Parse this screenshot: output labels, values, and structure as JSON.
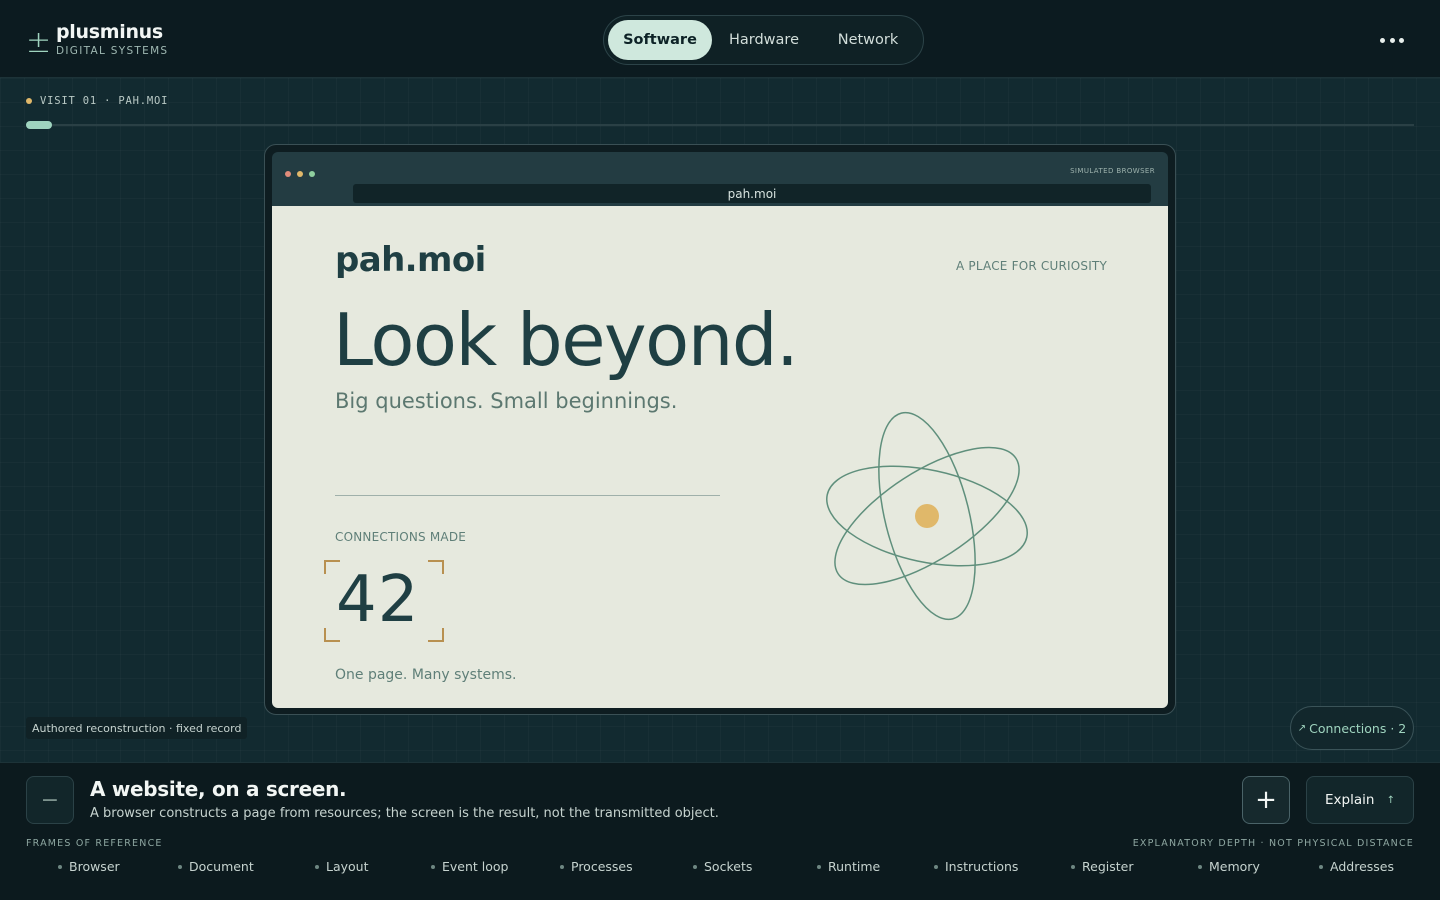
{
  "brand": {
    "mark": "±",
    "name": "plusminus",
    "subtitle": "DIGITAL SYSTEMS"
  },
  "nav": {
    "tabs": [
      {
        "label": "Software",
        "active": true
      },
      {
        "label": "Hardware"
      },
      {
        "label": "Network"
      }
    ]
  },
  "visit": {
    "label": "VISIT 01 · PAH.MOI"
  },
  "browser": {
    "simulated_label": "SIMULATED BROWSER",
    "url": "pah.moi",
    "traffic_colors": [
      "#e08c7a",
      "#e0b86a",
      "#8fcf9f"
    ],
    "page": {
      "site_name": "pah.moi",
      "tagline": "A PLACE FOR CURIOSITY",
      "headline": "Look beyond.",
      "subheadline": "Big questions. Small beginnings.",
      "connections_label": "CONNECTIONS MADE",
      "connections_count": "42",
      "footer": "One page. Many systems."
    }
  },
  "authored_note": "Authored reconstruction · fixed record",
  "connections_button": {
    "icon": "↗",
    "label": "Connections · 2"
  },
  "panel": {
    "minus_label": "−",
    "title": "A website, on a screen.",
    "description": "A browser constructs a page from resources; the screen is the result, not the transmitted object.",
    "plus_label": "+",
    "explain_label": "Explain",
    "explain_icon": "↑",
    "frames_label": "FRAMES OF REFERENCE",
    "depth_label": "EXPLANATORY DEPTH · NOT PHYSICAL DISTANCE",
    "frames": [
      "Browser",
      "Document",
      "Layout",
      "Event loop",
      "Processes",
      "Sockets",
      "Runtime",
      "Instructions",
      "Register",
      "Memory",
      "Addresses"
    ],
    "position": 0
  },
  "colors": {
    "accent": "#9fd4bf",
    "gold": "#e0b86a",
    "page_bg": "#e6e9de",
    "ink": "#1f3f43"
  }
}
